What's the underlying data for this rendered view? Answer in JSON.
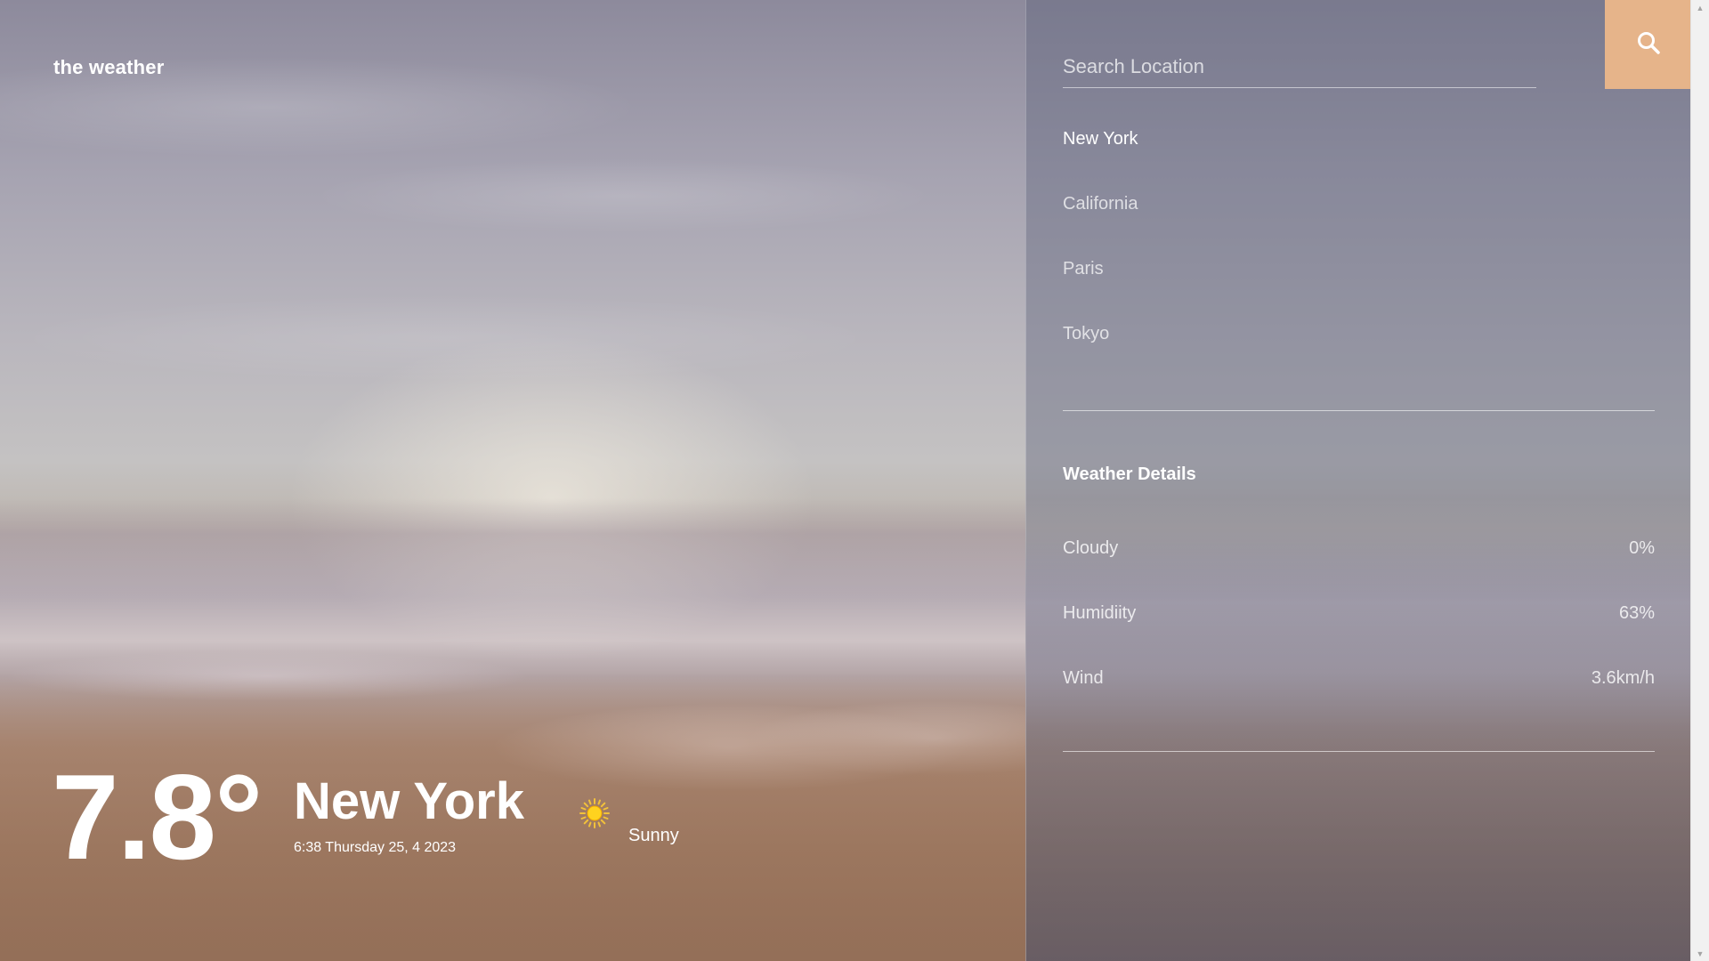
{
  "app": {
    "brand": "the weather"
  },
  "current": {
    "temperature": "7.8°",
    "city": "New York",
    "datetime": "6:38 Thursday 25, 4 2023",
    "condition": "Sunny",
    "condition_icon": "sun-icon"
  },
  "search": {
    "placeholder": "Search Location",
    "value": "",
    "button_icon": "search-icon",
    "button_color": "#e6b48a"
  },
  "locations": [
    {
      "label": "New York",
      "active": true
    },
    {
      "label": "California",
      "active": false
    },
    {
      "label": "Paris",
      "active": false
    },
    {
      "label": "Tokyo",
      "active": false
    }
  ],
  "details": {
    "title": "Weather Details",
    "rows": [
      {
        "label": "Cloudy",
        "value": "0%"
      },
      {
        "label": "Humidiity",
        "value": "63%"
      },
      {
        "label": "Wind",
        "value": "3.6km/h"
      }
    ]
  },
  "scrollbar": {
    "up_icon": "scroll-up-arrow-icon",
    "down_icon": "scroll-down-arrow-icon"
  }
}
